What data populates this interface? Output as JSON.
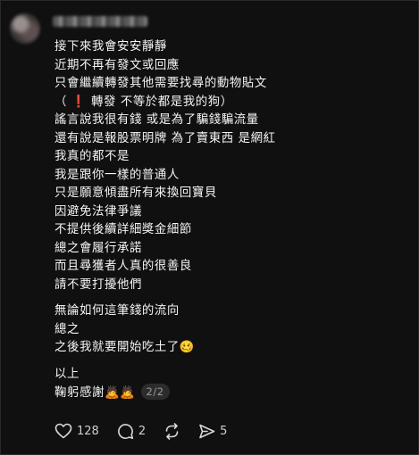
{
  "post": {
    "lines": [
      "接下來我會安安靜靜",
      "近期不再有發文或回應",
      "只會繼續轉發其他需要找尋的動物貼文",
      "（ ❗ 轉發 不等於都是我的狗）",
      "謠言說我很有錢 或是為了騙錢騙流量",
      "還有說是報股票明牌 為了賣東西 是網紅",
      "我真的都不是",
      "我是跟你一樣的普通人",
      "只是願意傾盡所有來換回寶貝",
      "因避免法律爭議",
      "不提供後續詳細獎金細節",
      "總之會履行承諾",
      "而且尋獲者人真的很善良",
      "請不要打擾他們",
      "無論如何這筆錢的流向",
      "總之",
      "之後我就要開始吃土了🥴",
      "以上",
      "鞠躬感謝🙇🙇"
    ],
    "page_indicator": "2/2"
  },
  "actions": {
    "like_count": "128",
    "comment_count": "2",
    "share_count": "5"
  }
}
